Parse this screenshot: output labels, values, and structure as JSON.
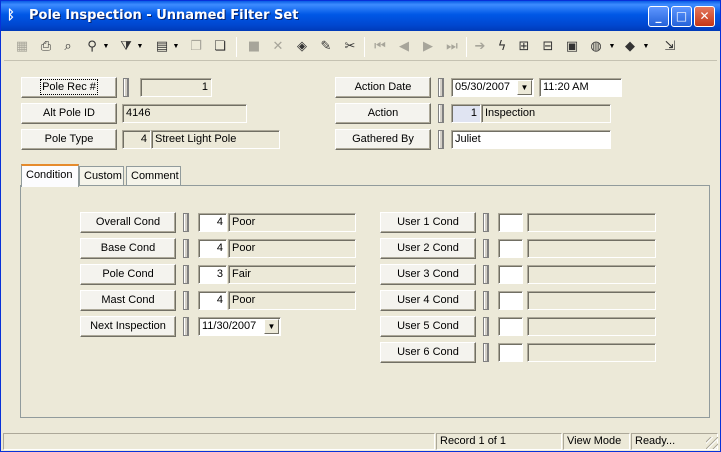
{
  "window": {
    "title": "Pole Inspection - Unnamed Filter Set",
    "icon": "pole-app-icon",
    "controls": {
      "minimize": "minimize-icon",
      "maximize": "maximize-icon",
      "close": "close-icon"
    }
  },
  "toolbar": {
    "icons": [
      "grid-icon",
      "print-icon",
      "print-preview-icon",
      "binoculars-icon",
      "filter-icon",
      "report-icon",
      "copy-record-icon",
      "paste-record-icon",
      "save-icon",
      "delete-icon",
      "layers-icon",
      "pencil-icon",
      "scissors-icon",
      "first-record-icon",
      "previous-record-icon",
      "next-record-icon",
      "last-record-icon",
      "go-to-icon",
      "lightning-icon",
      "map-link-icon",
      "hierarchy-icon",
      "map-icon",
      "globe-icon",
      "book-icon",
      "exit-icon"
    ]
  },
  "header": {
    "pole_rec": {
      "label": "Pole Rec #",
      "value": "1"
    },
    "alt_pole_id": {
      "label": "Alt Pole ID",
      "value": "4146"
    },
    "pole_type": {
      "label": "Pole Type",
      "code": "4",
      "value": "Street Light Pole"
    },
    "action_date": {
      "label": "Action Date",
      "date": "05/30/2007",
      "time": "11:20 AM"
    },
    "action": {
      "label": "Action",
      "code": "1",
      "value": "Inspection"
    },
    "gathered_by": {
      "label": "Gathered By",
      "value": "Juliet"
    }
  },
  "tabs": [
    {
      "label": "Condition",
      "active": true
    },
    {
      "label": "Custom",
      "active": false
    },
    {
      "label": "Comment",
      "active": false
    }
  ],
  "condition": {
    "rows": [
      {
        "label": "Overall Cond",
        "code": "4",
        "value": "Poor"
      },
      {
        "label": "Base Cond",
        "code": "4",
        "value": "Poor"
      },
      {
        "label": "Pole Cond",
        "code": "3",
        "value": "Fair"
      },
      {
        "label": "Mast Cond",
        "code": "4",
        "value": "Poor"
      }
    ],
    "next_inspection": {
      "label": "Next Inspection",
      "value": "11/30/2007"
    },
    "user_rows": [
      {
        "label": "User 1 Cond",
        "code": "",
        "value": ""
      },
      {
        "label": "User 2 Cond",
        "code": "",
        "value": ""
      },
      {
        "label": "User 3 Cond",
        "code": "",
        "value": ""
      },
      {
        "label": "User 4 Cond",
        "code": "",
        "value": ""
      },
      {
        "label": "User 5 Cond",
        "code": "",
        "value": ""
      },
      {
        "label": "User 6 Cond",
        "code": "",
        "value": ""
      }
    ]
  },
  "status": {
    "blank": "",
    "record": "Record 1 of 1",
    "mode": "View Mode",
    "state": "Ready..."
  },
  "colors": {
    "titlebar": "#0054e3",
    "face": "#ece9d8",
    "active_tab_accent": "#e68b2c"
  }
}
